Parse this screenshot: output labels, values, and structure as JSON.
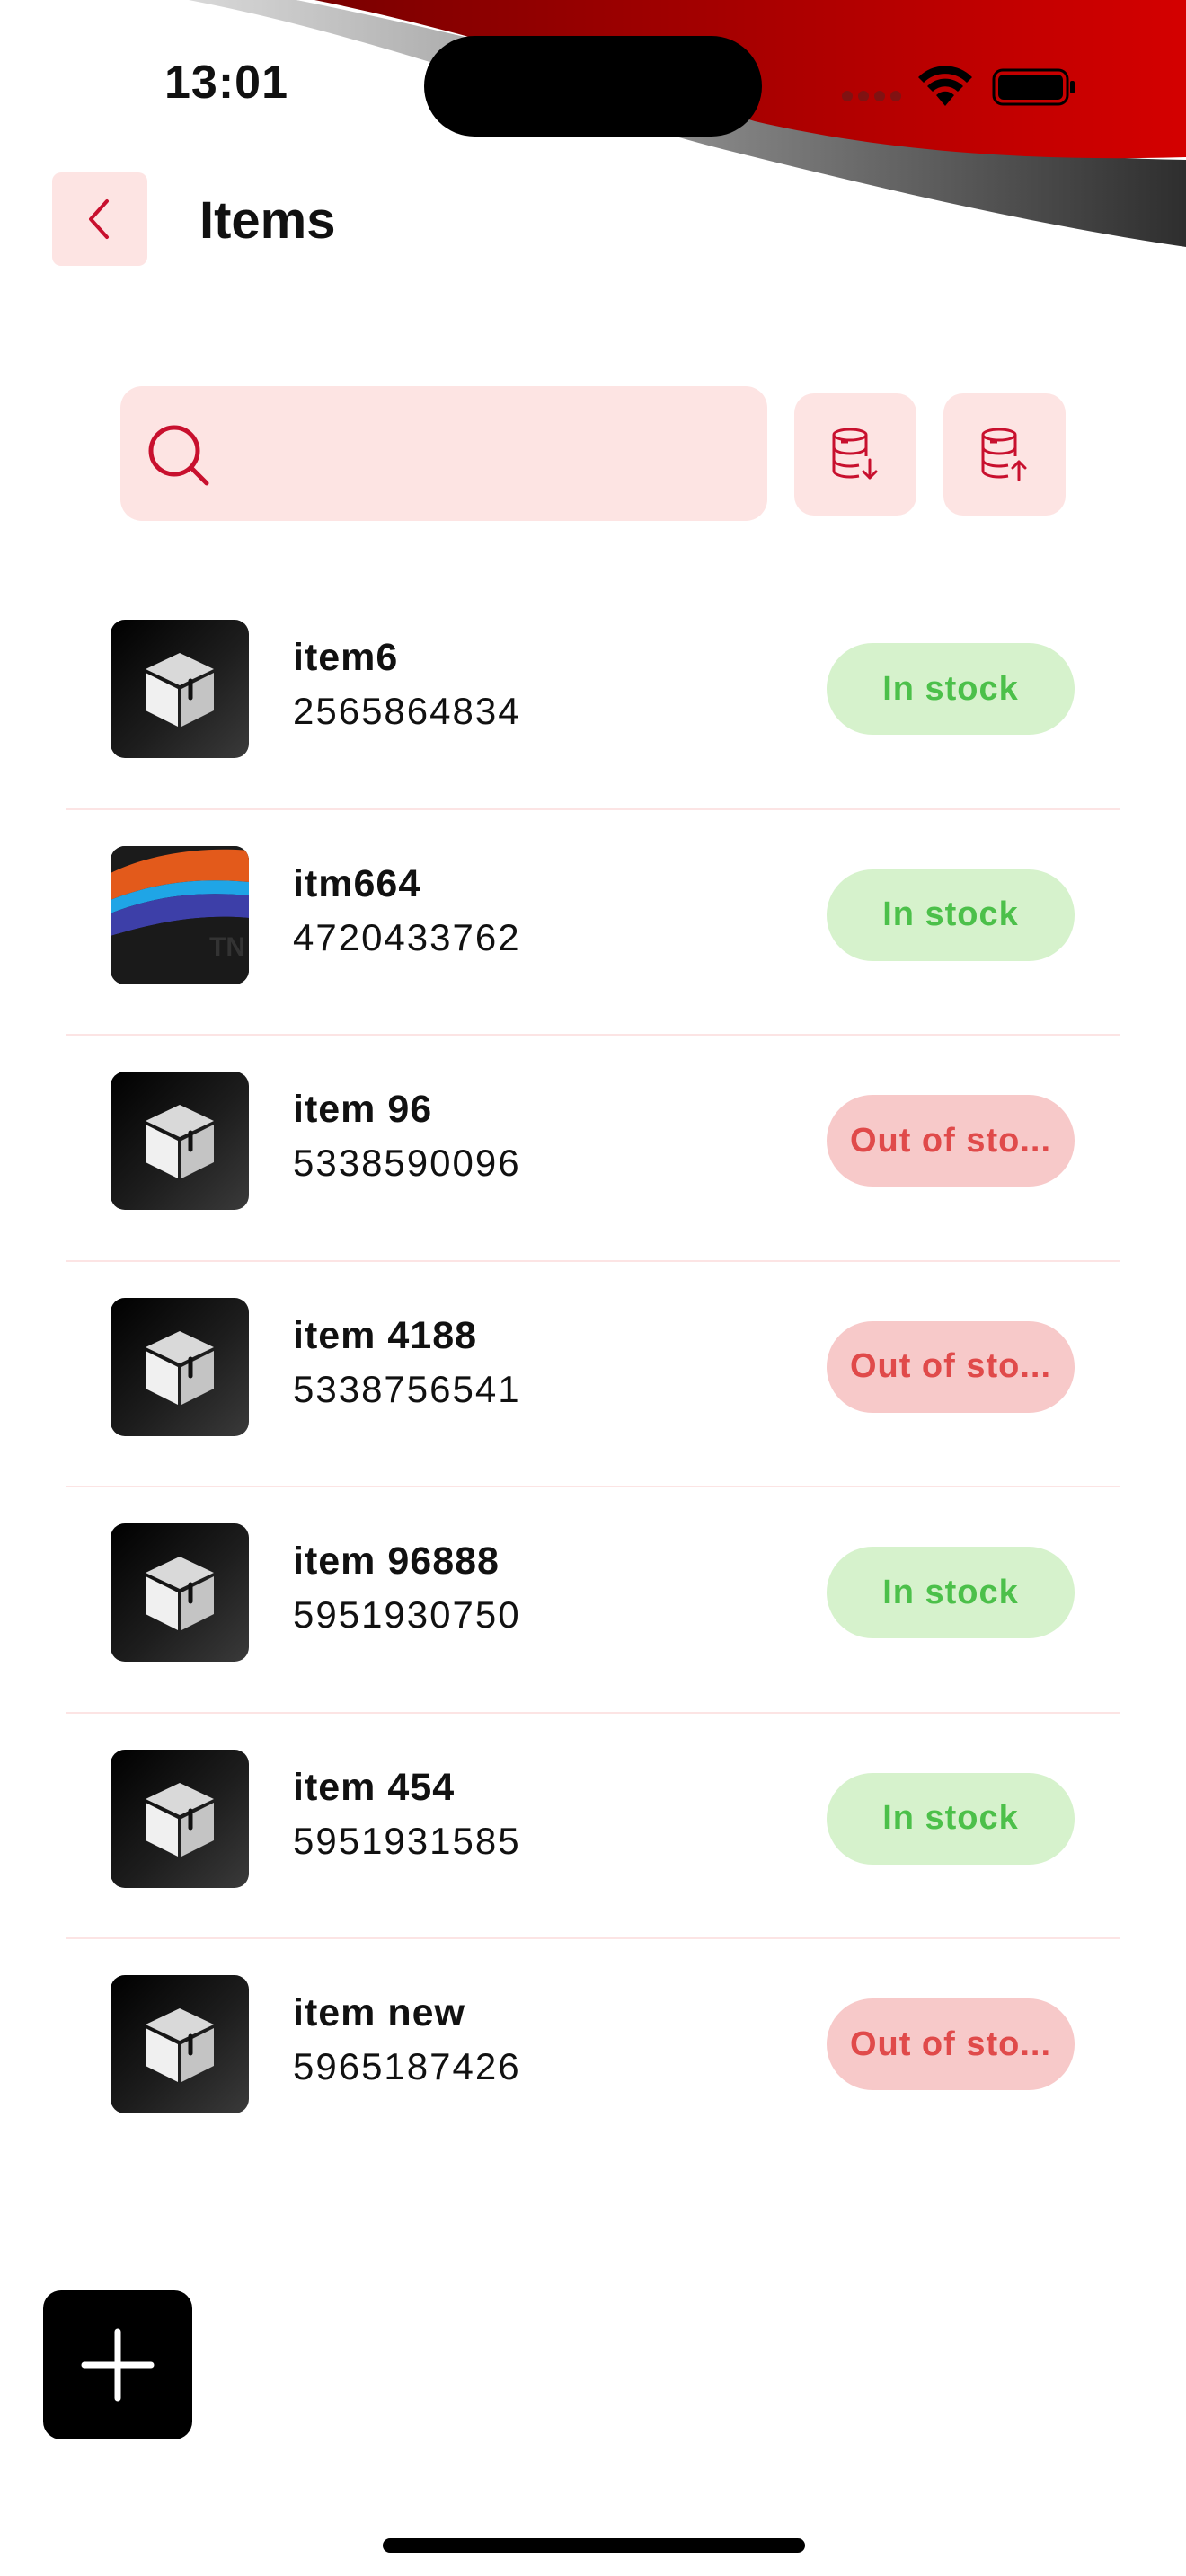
{
  "status_bar": {
    "time": "13:01"
  },
  "header": {
    "title": "Items",
    "back_icon": "chevron-left-icon"
  },
  "search": {
    "placeholder": "",
    "value": "",
    "icon": "search-icon"
  },
  "actions": [
    {
      "name": "database-download-icon"
    },
    {
      "name": "database-upload-icon"
    }
  ],
  "items": [
    {
      "name": "item6",
      "code": "2565864834",
      "status": "In stock",
      "in_stock": true,
      "thumbnail": "box-icon"
    },
    {
      "name": "itm664",
      "code": "4720433762",
      "status": "In stock",
      "in_stock": true,
      "thumbnail": "photo"
    },
    {
      "name": "item 96",
      "code": "5338590096",
      "status": "Out of sto...",
      "in_stock": false,
      "thumbnail": "box-icon"
    },
    {
      "name": "item 4188",
      "code": "5338756541",
      "status": "Out of sto...",
      "in_stock": false,
      "thumbnail": "box-icon"
    },
    {
      "name": "item 96888",
      "code": "5951930750",
      "status": "In stock",
      "in_stock": true,
      "thumbnail": "box-icon"
    },
    {
      "name": "item 454",
      "code": "5951931585",
      "status": "In stock",
      "in_stock": true,
      "thumbnail": "box-icon"
    },
    {
      "name": "item new",
      "code": "5965187426",
      "status": "Out of sto...",
      "in_stock": false,
      "thumbnail": "box-icon"
    }
  ],
  "fab": {
    "icon": "plus-icon"
  },
  "colors": {
    "accent": "#c8102e",
    "tint_background": "#fde4e3",
    "in_stock_bg": "#d6f2cc",
    "in_stock_text": "#4cc04a",
    "out_stock_bg": "#f7c9c9",
    "out_stock_text": "#e04a4a"
  }
}
